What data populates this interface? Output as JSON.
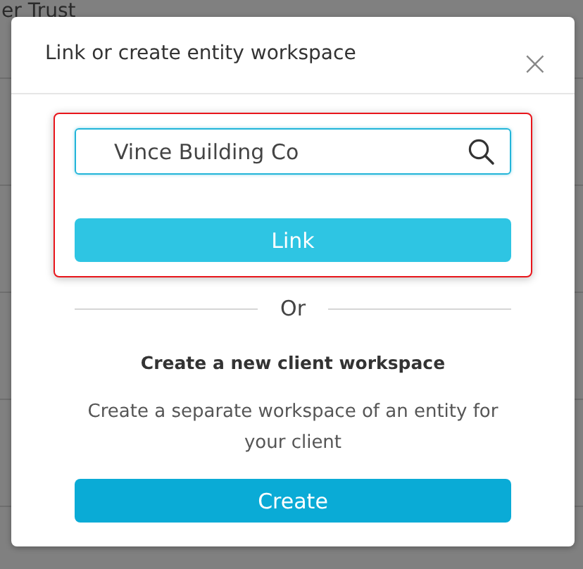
{
  "background": {
    "rows": [
      {
        "lines": [
          "er Trust"
        ]
      },
      {
        "kind": "row"
      },
      {
        "kind": "row"
      },
      {
        "kind": "row"
      },
      {
        "kind": "row"
      }
    ]
  },
  "dialog": {
    "title": "Link or create entity workspace",
    "close": "×",
    "search": {
      "value": "Vince Building Co"
    },
    "link_button": "Link",
    "divider_label": "Or",
    "section_title": "Create a new client workspace",
    "description": "Create a separate workspace of an entity for your client",
    "create_button": "Create"
  }
}
